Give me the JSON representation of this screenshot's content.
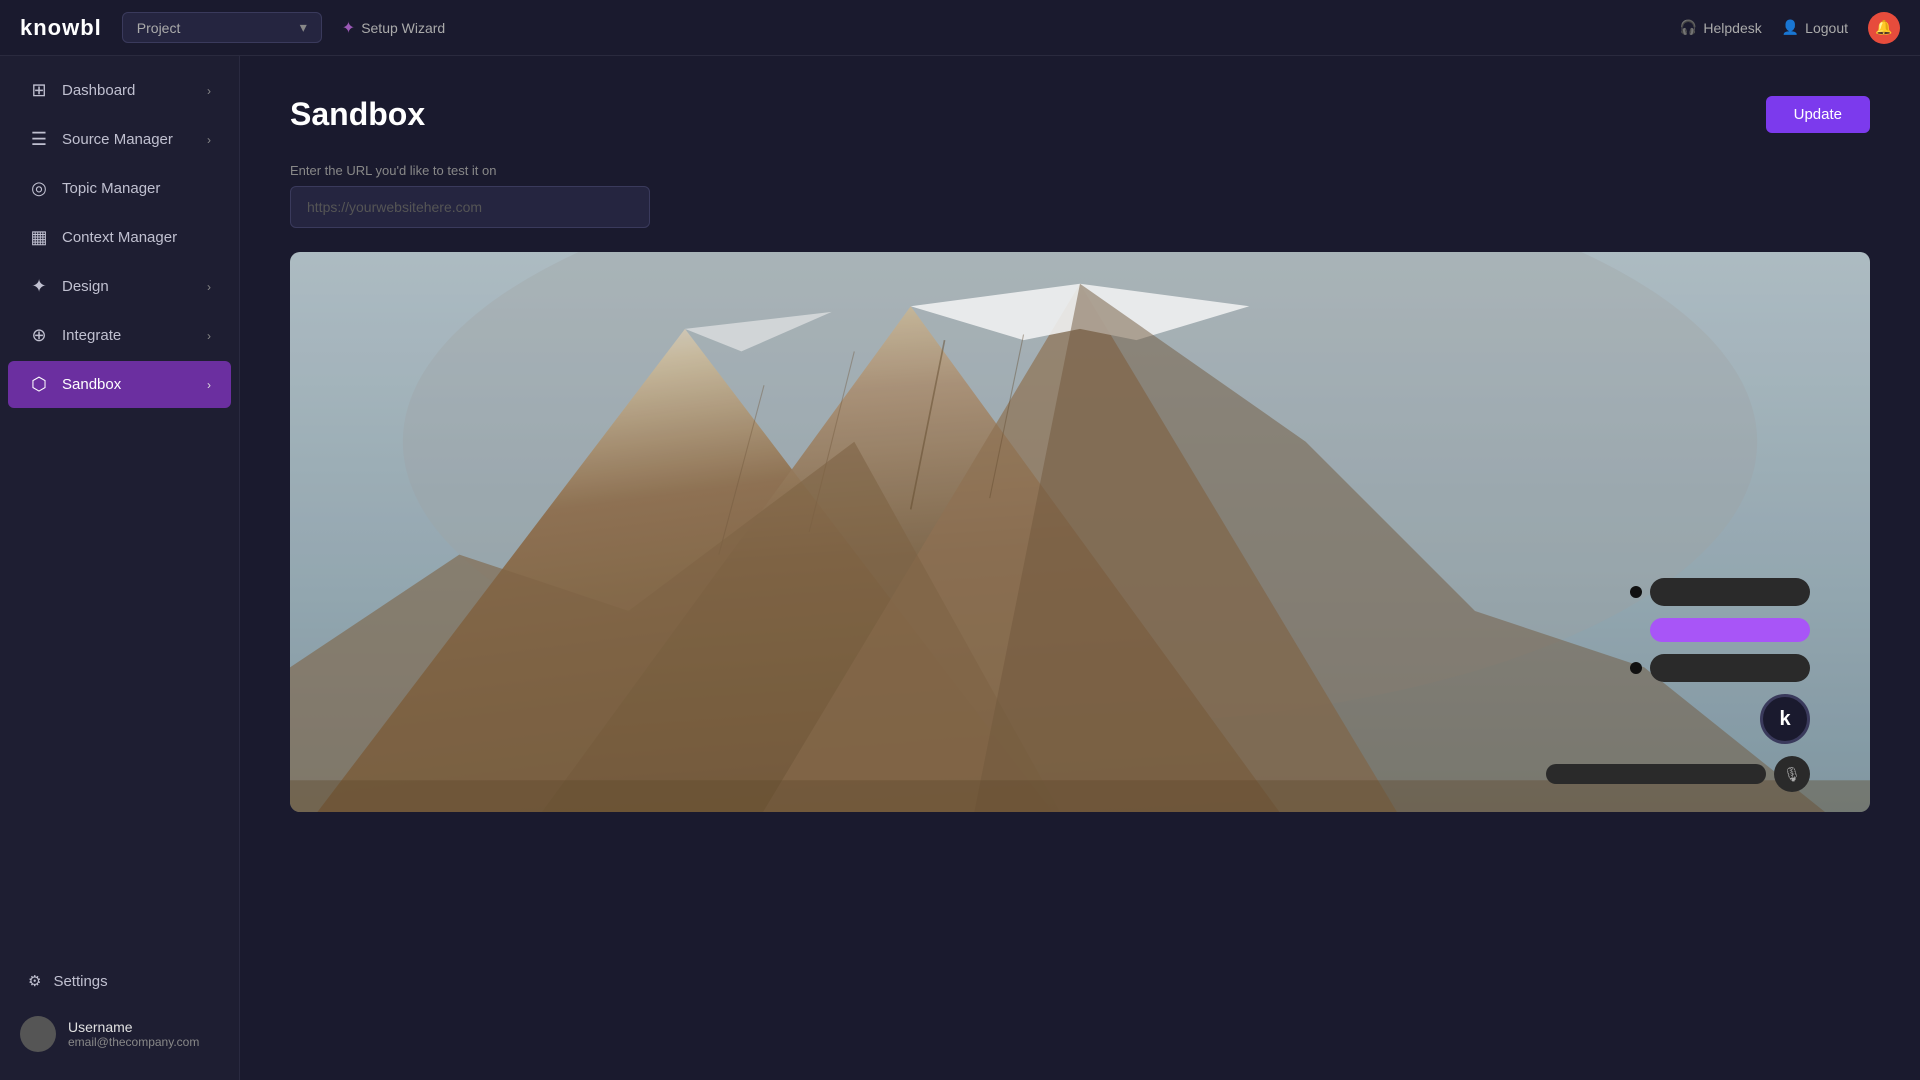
{
  "app": {
    "logo": "knowbl",
    "topbar": {
      "project_placeholder": "Project",
      "setup_wizard_label": "Setup Wizard",
      "helpdesk_label": "Helpdesk",
      "logout_label": "Logout"
    }
  },
  "sidebar": {
    "items": [
      {
        "id": "dashboard",
        "label": "Dashboard",
        "icon": "⊞",
        "has_arrow": true,
        "active": false
      },
      {
        "id": "source-manager",
        "label": "Source Manager",
        "icon": "☰",
        "has_arrow": true,
        "active": false
      },
      {
        "id": "topic-manager",
        "label": "Topic Manager",
        "icon": "◎",
        "has_arrow": false,
        "active": false
      },
      {
        "id": "context-manager",
        "label": "Context Manager",
        "icon": "▦",
        "has_arrow": false,
        "active": false
      },
      {
        "id": "design",
        "label": "Design",
        "icon": "✦",
        "has_arrow": true,
        "active": false
      },
      {
        "id": "integrate",
        "label": "Integrate",
        "icon": "⊕",
        "has_arrow": true,
        "active": false
      },
      {
        "id": "sandbox",
        "label": "Sandbox",
        "icon": "⬡",
        "has_arrow": true,
        "active": true
      }
    ],
    "settings_label": "Settings",
    "user": {
      "name": "Username",
      "email": "email@thecompany.com"
    }
  },
  "page": {
    "title": "Sandbox",
    "update_button": "Update",
    "url_label": "Enter the URL you'd like to test it on",
    "url_placeholder": "https://yourwebsitehere.com"
  },
  "chat_widget": {
    "bubble1_text": "",
    "purple_button_text": "",
    "bubble2_text": "",
    "input_placeholder": "",
    "k_letter": "k"
  }
}
